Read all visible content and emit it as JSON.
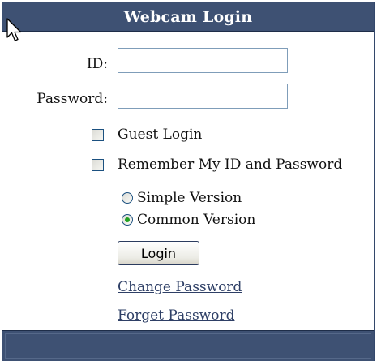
{
  "header": {
    "title": "Webcam Login"
  },
  "form": {
    "id_label": "ID:",
    "id_value": "",
    "password_label": "Password:",
    "password_value": "",
    "guest_login_label": "Guest Login",
    "guest_login_checked": false,
    "remember_label": "Remember My ID and Password",
    "remember_checked": false,
    "version_options": [
      {
        "label": "Simple Version",
        "selected": false
      },
      {
        "label": "Common Version",
        "selected": true
      }
    ],
    "login_button_label": "Login"
  },
  "links": {
    "change_password": "Change Password",
    "forget_password": "Forget Password"
  },
  "colors": {
    "header_bg": "#3e5173",
    "link": "#2e3f66",
    "radio_selected": "#21a121"
  },
  "icons": {
    "cursor": "mouse-pointer-icon"
  }
}
